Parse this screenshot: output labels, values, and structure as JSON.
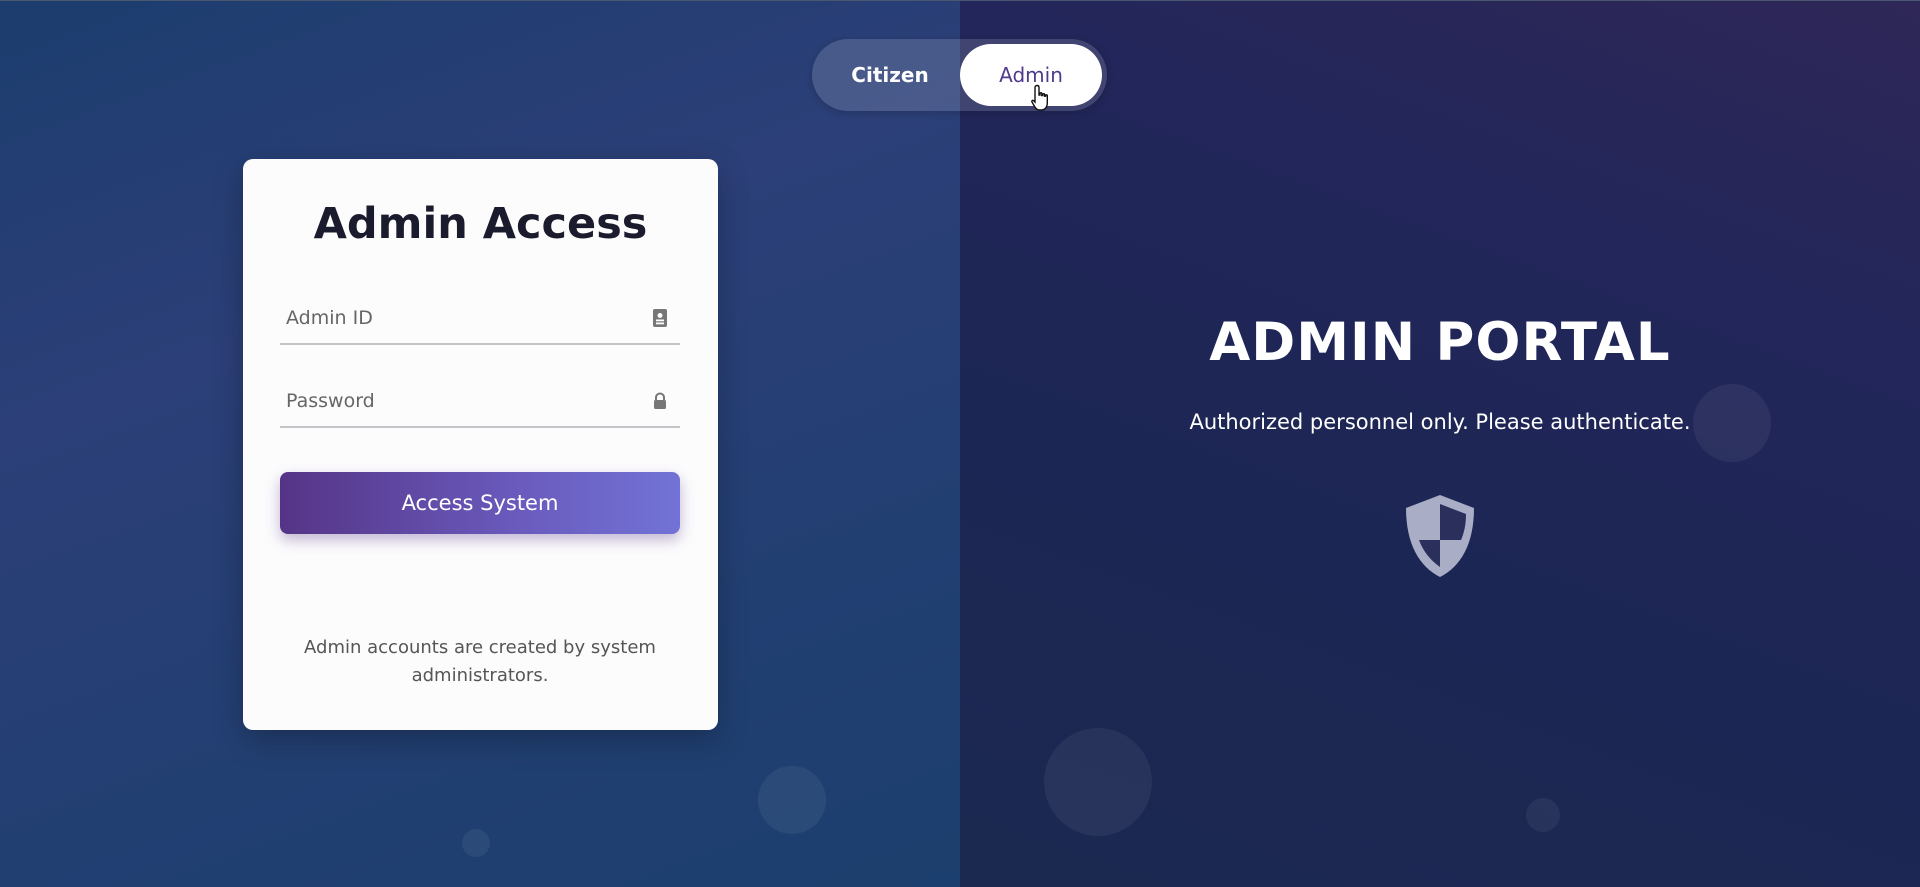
{
  "toggle": {
    "citizen_label": "Citizen",
    "admin_label": "Admin",
    "active": "Admin"
  },
  "login_card": {
    "title": "Admin Access",
    "admin_id_placeholder": "Admin ID",
    "admin_id_icon": "id-card-icon",
    "password_placeholder": "Password",
    "password_icon": "lock-icon",
    "submit_label": "Access System",
    "note": "Admin accounts are created by system administrators."
  },
  "portal": {
    "title": "ADMIN PORTAL",
    "subtitle": "Authorized personnel only. Please authenticate.",
    "icon": "shield-icon"
  },
  "colors": {
    "accent_start": "#553486",
    "accent_end": "#7273d6",
    "admin_text": "#4f3a8c",
    "card_bg": "#fcfcfd"
  }
}
